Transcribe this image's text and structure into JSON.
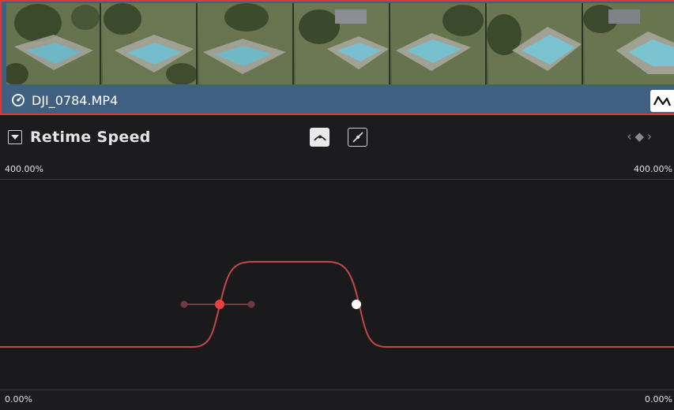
{
  "clip": {
    "filename": "DJI_0784.MP4",
    "thumbnail_count": 7
  },
  "retime": {
    "title": "Retime Speed",
    "top_left_label": "400.00%",
    "top_right_label": "400.00%",
    "bottom_left_label": "0.00%",
    "bottom_right_label": "0.00%"
  },
  "icons": {
    "clip_icon": "speedometer-icon",
    "curve_toggle": "curve-icon",
    "collapse": "chevron-down-icon",
    "smooth_mode": "smooth-curve-icon",
    "linear_mode": "linear-curve-icon",
    "prev_keyframe": "chevron-left-icon",
    "keyframe": "diamond-icon",
    "next_keyframe": "chevron-right-icon"
  },
  "colors": {
    "selection_border": "#d63a3a",
    "clip_bar": "#3f6080",
    "curve": "#c04a4a",
    "selected_keyframe": "#e8403c",
    "keyframe": "#ffffff"
  }
}
